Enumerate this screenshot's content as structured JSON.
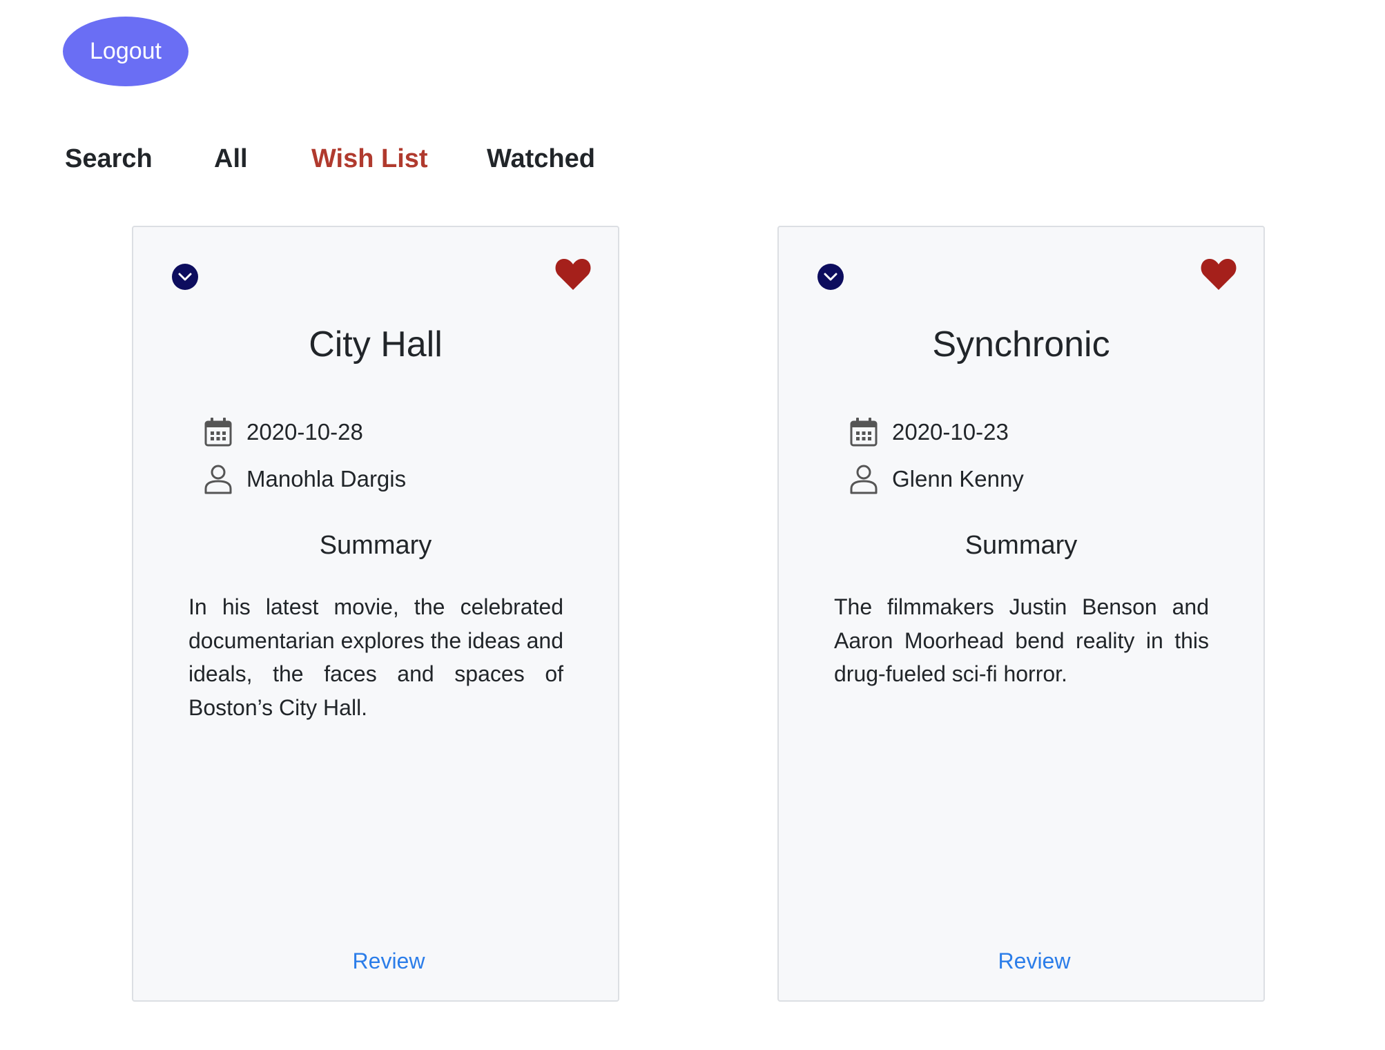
{
  "header": {
    "logout_label": "Logout"
  },
  "nav": {
    "tabs": [
      {
        "label": "Search",
        "active": false
      },
      {
        "label": "All",
        "active": false
      },
      {
        "label": "Wish List",
        "active": true
      },
      {
        "label": "Watched",
        "active": false
      }
    ]
  },
  "colors": {
    "accent_button": "#6a6ef4",
    "active_tab": "#b03a2e",
    "heart": "#a5201b",
    "expand_icon": "#0d0d5e",
    "link": "#2b7de9"
  },
  "cards": [
    {
      "title": "City Hall",
      "date": "2020-10-28",
      "critic": "Manohla Dargis",
      "summary_heading": "Summary",
      "summary": "In his latest movie, the celebrated documentarian explores the ideas and ideals, the faces and spaces of Boston’s City Hall.",
      "review_label": "Review",
      "icons": {
        "expand": "chevron-down-circle-icon",
        "favorite": "heart-icon",
        "date": "calendar-icon",
        "critic": "user-icon"
      }
    },
    {
      "title": "Synchronic",
      "date": "2020-10-23",
      "critic": "Glenn Kenny",
      "summary_heading": "Summary",
      "summary": "The filmmakers Justin Benson and Aaron Moorhead bend reality in this drug-fueled sci-fi horror.",
      "review_label": "Review",
      "icons": {
        "expand": "chevron-down-circle-icon",
        "favorite": "heart-icon",
        "date": "calendar-icon",
        "critic": "user-icon"
      }
    }
  ]
}
